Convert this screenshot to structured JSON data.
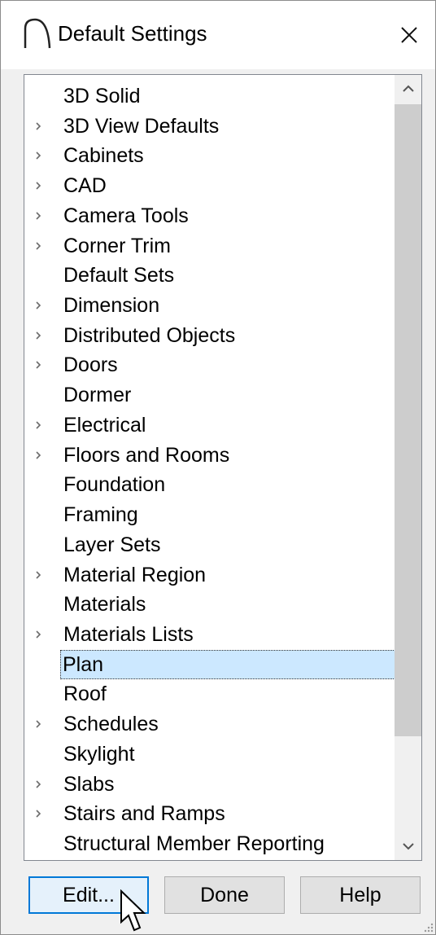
{
  "window": {
    "title": "Default Settings"
  },
  "tree": {
    "items": [
      {
        "label": "3D Solid",
        "expandable": false
      },
      {
        "label": "3D View Defaults",
        "expandable": true
      },
      {
        "label": "Cabinets",
        "expandable": true
      },
      {
        "label": "CAD",
        "expandable": true
      },
      {
        "label": "Camera Tools",
        "expandable": true
      },
      {
        "label": "Corner Trim",
        "expandable": true
      },
      {
        "label": "Default Sets",
        "expandable": false
      },
      {
        "label": "Dimension",
        "expandable": true
      },
      {
        "label": "Distributed Objects",
        "expandable": true
      },
      {
        "label": "Doors",
        "expandable": true
      },
      {
        "label": "Dormer",
        "expandable": false
      },
      {
        "label": "Electrical",
        "expandable": true
      },
      {
        "label": "Floors and Rooms",
        "expandable": true
      },
      {
        "label": "Foundation",
        "expandable": false
      },
      {
        "label": "Framing",
        "expandable": false
      },
      {
        "label": "Layer Sets",
        "expandable": false
      },
      {
        "label": "Material Region",
        "expandable": true
      },
      {
        "label": "Materials",
        "expandable": false
      },
      {
        "label": "Materials Lists",
        "expandable": true
      },
      {
        "label": "Plan",
        "expandable": false,
        "selected": true
      },
      {
        "label": "Roof",
        "expandable": false
      },
      {
        "label": "Schedules",
        "expandable": true
      },
      {
        "label": "Skylight",
        "expandable": false
      },
      {
        "label": "Slabs",
        "expandable": true
      },
      {
        "label": "Stairs and Ramps",
        "expandable": true
      },
      {
        "label": "Structural Member Reporting",
        "expandable": false
      }
    ]
  },
  "buttons": {
    "edit": "Edit...",
    "done": "Done",
    "help": "Help"
  },
  "colors": {
    "selection": "#cce8ff",
    "focus_border": "#0078d7",
    "icon": "#6b6b6b"
  },
  "icons": {
    "app": "arch-icon",
    "close": "close-icon",
    "expand": "chevron-right-icon",
    "scroll_up": "chevron-up-icon",
    "scroll_down": "chevron-down-icon",
    "cursor": "pointer-cursor-icon"
  }
}
